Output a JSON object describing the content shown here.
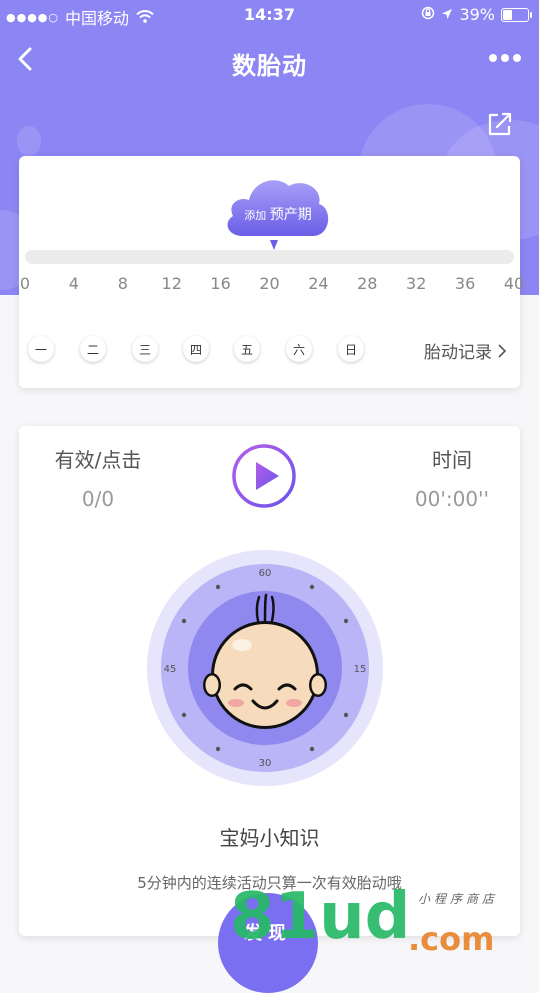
{
  "status_bar": {
    "signal_dots": "●●●●○",
    "carrier": "中国移动",
    "time": "14:37",
    "battery_percent": "39%",
    "battery_level": 0.39
  },
  "nav": {
    "title": "数胎动"
  },
  "due_date": {
    "add_prefix": "添加",
    "label": "预产期"
  },
  "week_ticks": [
    "0",
    "4",
    "8",
    "12",
    "16",
    "20",
    "24",
    "28",
    "32",
    "36",
    "40"
  ],
  "weekdays": [
    "一",
    "二",
    "三",
    "四",
    "五",
    "六",
    "日"
  ],
  "record_link": "胎动记录",
  "counter": {
    "effective_label": "有效/点击",
    "effective_value": "0/0",
    "time_label": "时间",
    "time_value": "00':00''"
  },
  "dial": {
    "top": "60",
    "right": "15",
    "bottom": "30",
    "left": "45"
  },
  "tips": {
    "title": "宝妈小知识",
    "text": "5分钟内的连续活动只算一次有效胎动哦"
  },
  "discover_label": "发现",
  "watermark": {
    "letters": "81ud",
    "domain": ".com",
    "tagline": "小程序商店"
  },
  "colors": {
    "primary": "#8c86f4",
    "accent": "#7a5cf0",
    "dial_outer": "#e6e5fb",
    "dial_ring": "#b9b5f6",
    "dial_inner": "#8e88ef"
  }
}
